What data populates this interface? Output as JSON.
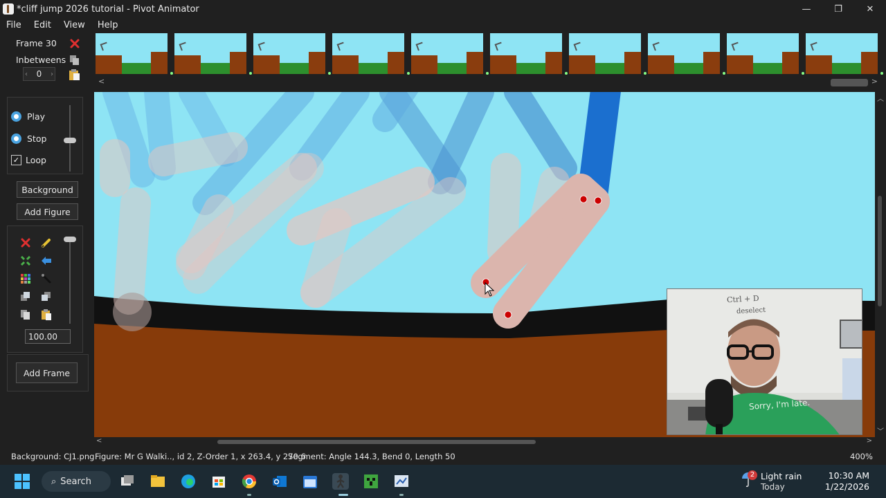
{
  "window": {
    "title": "*cliff jump 2026 tutorial - Pivot Animator",
    "minimize": "—",
    "restore": "❐",
    "close": "✕"
  },
  "menu": [
    "File",
    "Edit",
    "View",
    "Help"
  ],
  "frame_panel": {
    "frame_label": "Frame 30",
    "inbetweens_label": "Inbetweens",
    "inbetweens_value": "0"
  },
  "timeline": {
    "thumbnail_count": 10
  },
  "controls": {
    "play": "Play",
    "stop": "Stop",
    "loop": "Loop",
    "loop_checked": true,
    "background_button": "Background",
    "add_figure_button": "Add Figure",
    "scale_value": "100.00",
    "add_frame_button": "Add Frame"
  },
  "webcam": {
    "whiteboard_line1": "Ctrl + D",
    "whiteboard_line2": "deselect",
    "shirt_text": "Sorry, I'm late."
  },
  "status": {
    "background": "Background: CJ1.png",
    "figure": "Figure: Mr G Walki..,  id 2,  Z-Order 1,  x 263.4, y 270.6",
    "segment": "Segment: Angle 144.3,  Bend 0,  Length 50",
    "zoom": "400%"
  },
  "taskbar": {
    "search": "Search",
    "weather_badge": "2",
    "weather": "Light rain",
    "weather_sub": "Today",
    "time": "10:30 AM",
    "date": "1/22/2026"
  },
  "colors": {
    "sky": "#8ee4f4",
    "ground": "#8a3d0e",
    "limb": "#e0b8b0",
    "joint": "#cc0000",
    "figure_blue": "#1b6fcf"
  }
}
